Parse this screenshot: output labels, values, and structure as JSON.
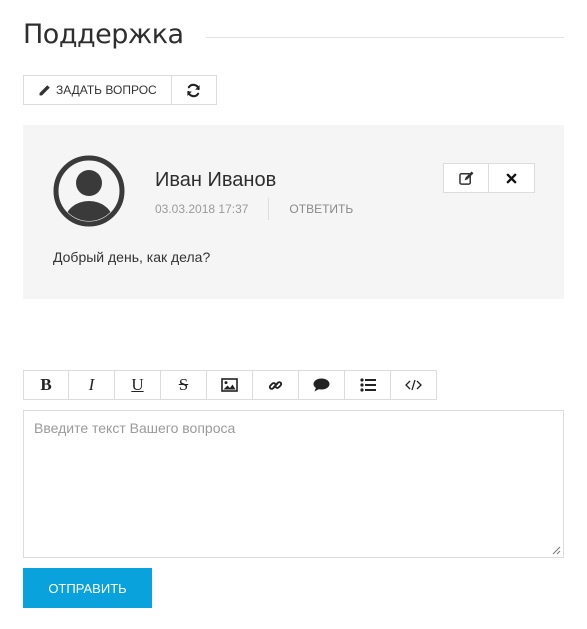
{
  "page": {
    "title": "Поддержка"
  },
  "toolbar": {
    "ask_label": "ЗАДАТЬ ВОПРОС",
    "ask_icon": "pencil-icon",
    "refresh_icon": "refresh-icon"
  },
  "comment": {
    "author": "Иван Иванов",
    "date": "03.03.2018 17:37",
    "reply_label": "ОТВЕТИТЬ",
    "text": "Добрый день, как дела?",
    "avatar_icon": "user-avatar-icon",
    "edit_icon": "edit-icon",
    "delete_icon": "close-icon"
  },
  "editor": {
    "buttons": [
      {
        "name": "bold",
        "label": "B"
      },
      {
        "name": "italic",
        "label": "I"
      },
      {
        "name": "underline",
        "label": "U"
      },
      {
        "name": "strikethrough",
        "label": "S"
      },
      {
        "name": "image",
        "icon": "image-icon"
      },
      {
        "name": "link",
        "icon": "link-icon"
      },
      {
        "name": "quote",
        "icon": "speech-bubble-icon"
      },
      {
        "name": "list",
        "icon": "list-icon"
      },
      {
        "name": "code",
        "icon": "code-icon"
      }
    ],
    "placeholder": "Введите текст Вашего вопроса",
    "value": ""
  },
  "submit": {
    "label": "ОТПРАВИТЬ"
  },
  "colors": {
    "accent": "#0aa2dc",
    "panel_bg": "#f5f5f5",
    "border": "#dcdcdc",
    "muted_text": "#9a9a9a",
    "avatar": "#3a3a3a"
  }
}
